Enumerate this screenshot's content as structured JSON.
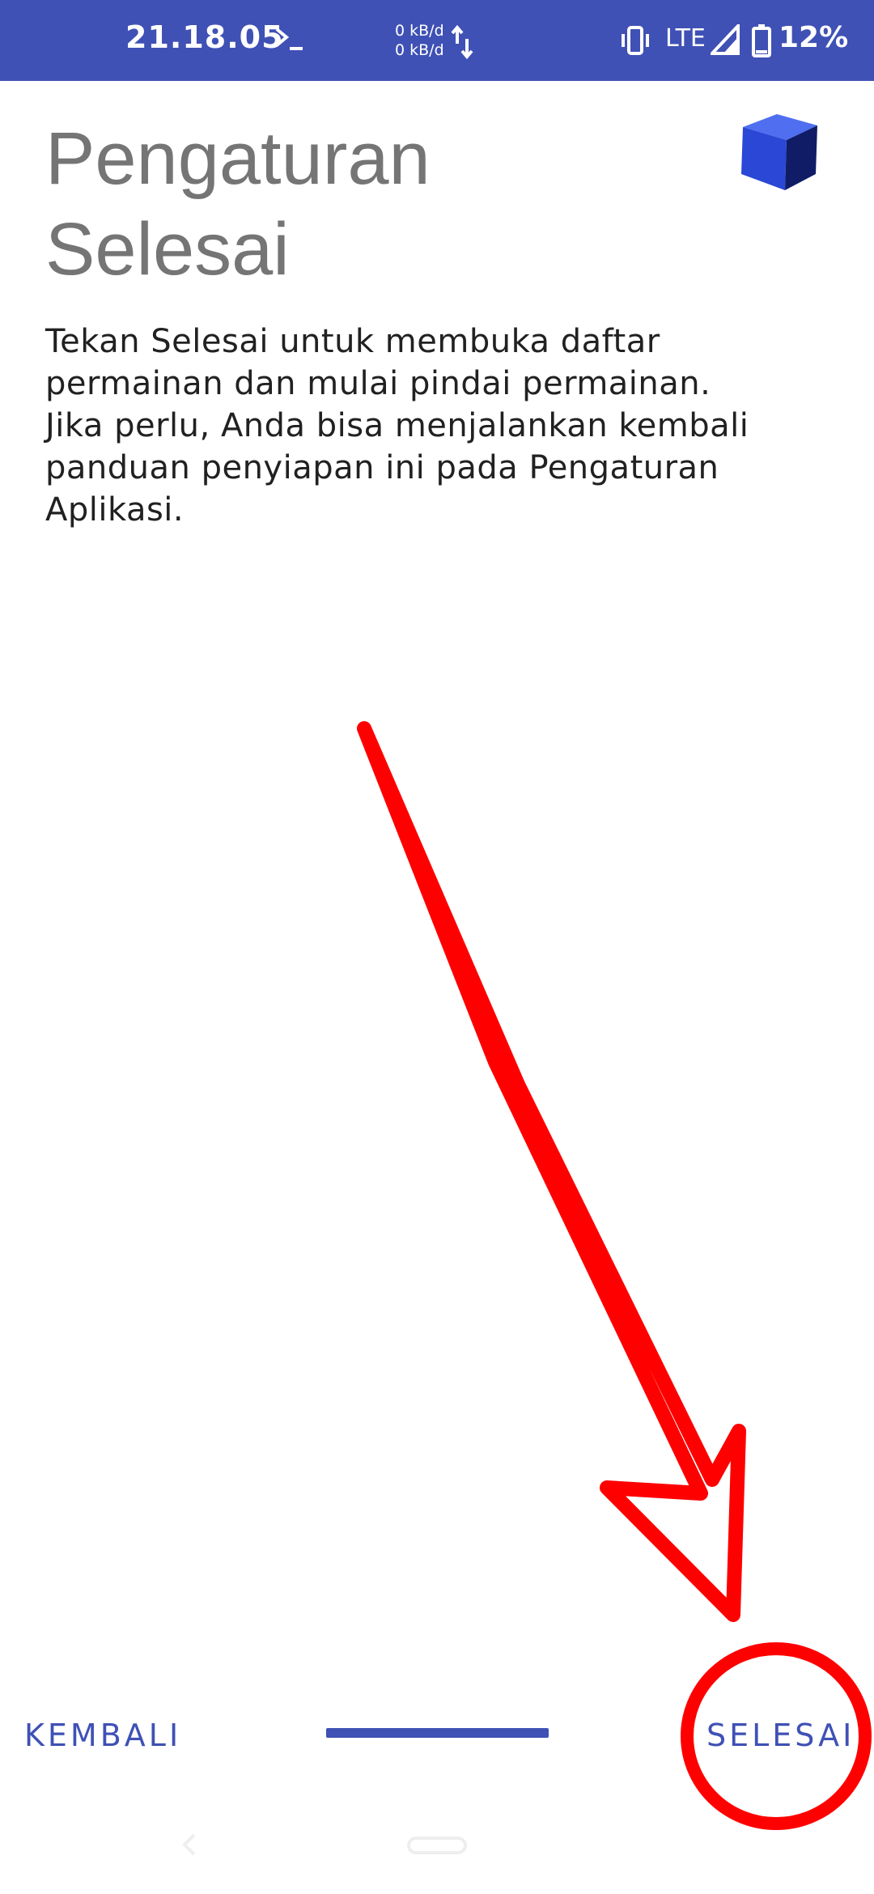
{
  "status_bar": {
    "time": "21.18.05",
    "data_up": "0 kB/d",
    "data_down": "0 kB/d",
    "network": "LTE",
    "battery": "12%",
    "icons": [
      "terminal-icon",
      "data-transfer-icon",
      "vibrate-icon",
      "signal-icon",
      "battery-icon"
    ],
    "background_color": "#3f51b5"
  },
  "header": {
    "title_line1": "Pengaturan",
    "title_line2": "Selesai",
    "logo_icon": "blue-cube-icon"
  },
  "body": {
    "lines": [
      "Tekan Selesai untuk membuka daftar",
      "permainan dan mulai pindai permainan.",
      "Jika perlu, Anda bisa menjalankan kembali",
      "panduan penyiapan ini pada Pengaturan",
      "Aplikasi."
    ]
  },
  "footer": {
    "back_label": "KEMBALI",
    "finish_label": "SELESAI",
    "accent_color": "#3f51b5"
  },
  "annotation": {
    "color": "#ff0000",
    "shapes": [
      "arrow",
      "circle"
    ]
  },
  "system_nav": {
    "icons": [
      "nav-back-icon",
      "nav-home-pill"
    ]
  }
}
